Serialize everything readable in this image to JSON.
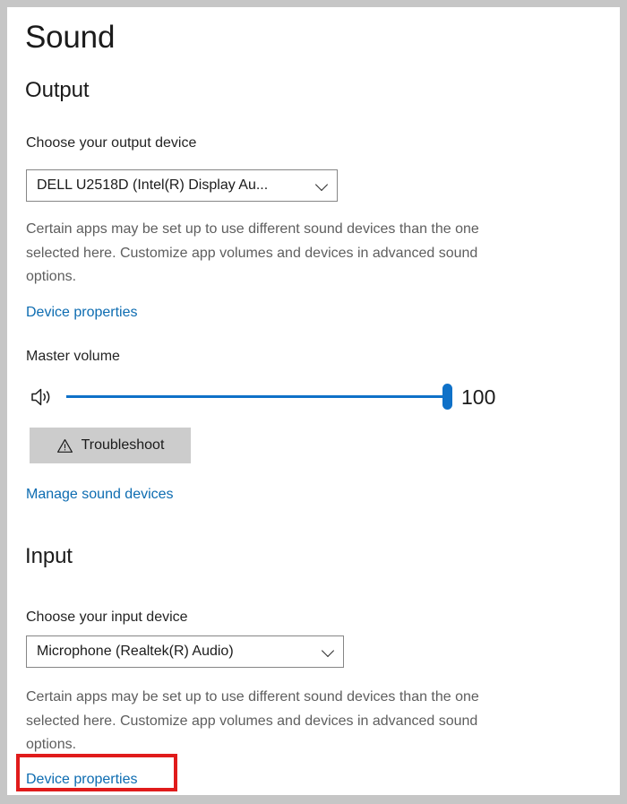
{
  "page": {
    "title": "Sound"
  },
  "output_section": {
    "heading": "Output",
    "device_label": "Choose your output device",
    "device_value": "DELL U2518D (Intel(R) Display Au...",
    "chevron_icon": "chevron-down-icon",
    "description": "Certain apps may be set up to use different sound devices than the one selected here. Customize app volumes and devices in advanced sound options.",
    "device_properties_link": "Device properties",
    "volume": {
      "label": "Master volume",
      "speaker_icon": "speaker-volume-icon",
      "value": "100",
      "percent": 100,
      "min": 0,
      "max": 100
    },
    "troubleshoot": {
      "label": "Troubleshoot",
      "icon": "warning-triangle-icon"
    },
    "manage_devices_link": "Manage sound devices"
  },
  "input_section": {
    "heading": "Input",
    "device_label": "Choose your input device",
    "device_value": "Microphone (Realtek(R) Audio)",
    "chevron_icon": "chevron-down-icon",
    "description": "Certain apps may be set up to use different sound devices than the one selected here. Customize app volumes and devices in advanced sound options.",
    "device_properties_link": "Device properties"
  },
  "annotation": {
    "type": "highlight-rectangle",
    "color": "#e01b1b",
    "target": "Device properties"
  },
  "colors": {
    "accent": "#0f71c8",
    "link": "#0d6cb1",
    "frame": "#c6c6c6",
    "button": "#cccccc",
    "annotation": "#e01b1b"
  }
}
